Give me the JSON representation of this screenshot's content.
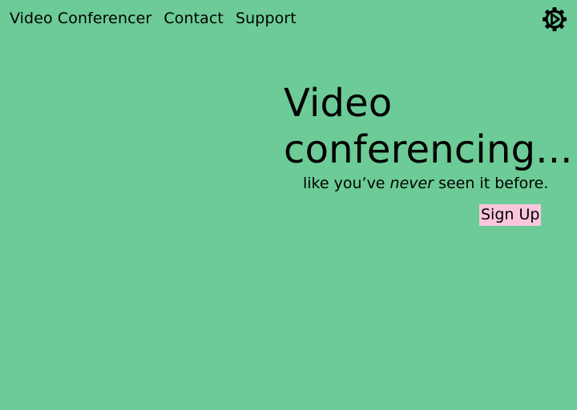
{
  "colors": {
    "background": "#6ccb96",
    "signup_bg": "#fbc6dc",
    "text": "#000000"
  },
  "nav": {
    "brand": "Video Conferencer",
    "items": [
      {
        "label": "Contact"
      },
      {
        "label": "Support"
      }
    ]
  },
  "settings": {
    "icon": "gear-icon"
  },
  "hero": {
    "title_line1": "Video",
    "title_line2": "conferencing...",
    "tagline_before": "like you’ve ",
    "tagline_em": "never",
    "tagline_after": " seen it before.",
    "cta_label": "Sign Up"
  }
}
